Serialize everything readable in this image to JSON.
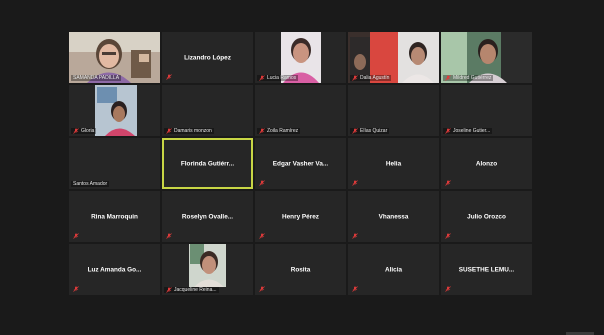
{
  "colors": {
    "background": "#1a1a1a",
    "tile": "#262626",
    "active_speaker_border": "#c8d645",
    "muted_icon": "#e03a3a"
  },
  "participants": [
    {
      "name": "SAMANDA PADILLA",
      "display": "video",
      "muted": false
    },
    {
      "name": "Lizandro López",
      "display": "name",
      "muted": true
    },
    {
      "name": "Lucia Ramos",
      "display": "video",
      "muted": true
    },
    {
      "name": "Dalia Agustín",
      "display": "video",
      "muted": true
    },
    {
      "name": "Mildred Gutiérrez",
      "display": "video",
      "muted": true
    },
    {
      "name": "Gloria",
      "display": "video",
      "muted": true
    },
    {
      "name": "Damaris monzon",
      "display": "label",
      "muted": true
    },
    {
      "name": "Zoila Ramírez",
      "display": "label",
      "muted": true
    },
    {
      "name": "Elías Quizar",
      "display": "label",
      "muted": true
    },
    {
      "name": "Joseline Gutier...",
      "display": "label",
      "muted": true
    },
    {
      "name": "Santos Amador",
      "display": "label",
      "muted": false
    },
    {
      "name": "Florinda Gutiérr...",
      "display": "name",
      "muted": false,
      "active": true
    },
    {
      "name": "Edgar Vasher Va...",
      "display": "name",
      "muted": true
    },
    {
      "name": "Helia",
      "display": "name",
      "muted": true
    },
    {
      "name": "Alonzo",
      "display": "name",
      "muted": true
    },
    {
      "name": "Rina Marroquin",
      "display": "name",
      "muted": true
    },
    {
      "name": "Roselyn Ovalle...",
      "display": "name",
      "muted": true
    },
    {
      "name": "Henry Pérez",
      "display": "name",
      "muted": true
    },
    {
      "name": "Vhanessa",
      "display": "name",
      "muted": true
    },
    {
      "name": "Julio Orozco",
      "display": "name",
      "muted": true
    },
    {
      "name": "Luz Amanda Go...",
      "display": "name",
      "muted": true
    },
    {
      "name": "Jacqueline Reina...",
      "display": "video",
      "muted": true
    },
    {
      "name": "Rosita",
      "display": "name",
      "muted": true
    },
    {
      "name": "Alicia",
      "display": "name",
      "muted": true
    },
    {
      "name": "SUSETHE LEMU...",
      "display": "name",
      "muted": true
    }
  ]
}
